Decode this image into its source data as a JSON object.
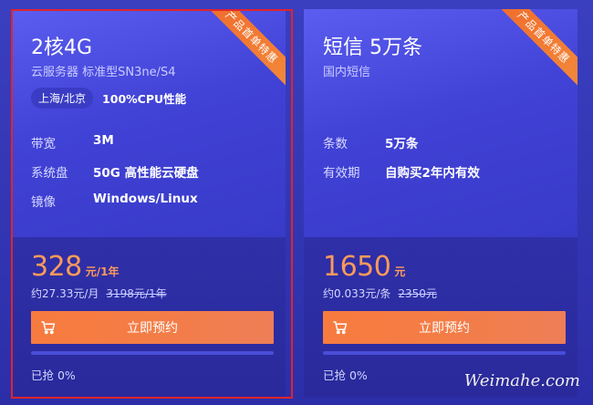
{
  "colors": {
    "accent": "#f77b3f",
    "price": "#ff9a5a",
    "card_bg": "#4142d6",
    "selected_border": "#e0242b"
  },
  "cards": [
    {
      "ribbon": "产品首单特惠",
      "title": "2核4G",
      "subtitle": "云服务器 标准型SN3ne/S4",
      "chip": "上海/北京",
      "chip_text": "100%CPU性能",
      "specs": [
        {
          "label": "带宽",
          "value": "3M"
        },
        {
          "label": "系统盘",
          "value": "50G 高性能云硬盘"
        },
        {
          "label": "镜像",
          "value": "Windows/Linux"
        }
      ],
      "price": "328",
      "price_unit": "元/1年",
      "price_sub": "约27.33元/月",
      "original_price": "3198元/1年",
      "button": "立即预约",
      "progress": 0,
      "sold": "已抢 0%",
      "selected": true
    },
    {
      "ribbon": "产品首单特惠",
      "title": "短信 5万条",
      "subtitle": "国内短信",
      "specs": [
        {
          "label": "条数",
          "value": "5万条"
        },
        {
          "label": "有效期",
          "value": "自购买2年内有效"
        }
      ],
      "price": "1650",
      "price_unit": "元",
      "price_sub": "约0.033元/条",
      "original_price": "2350元",
      "button": "立即预约",
      "progress": 0,
      "sold": "已抢 0%",
      "selected": false
    }
  ],
  "watermark": "Weimahe.com"
}
